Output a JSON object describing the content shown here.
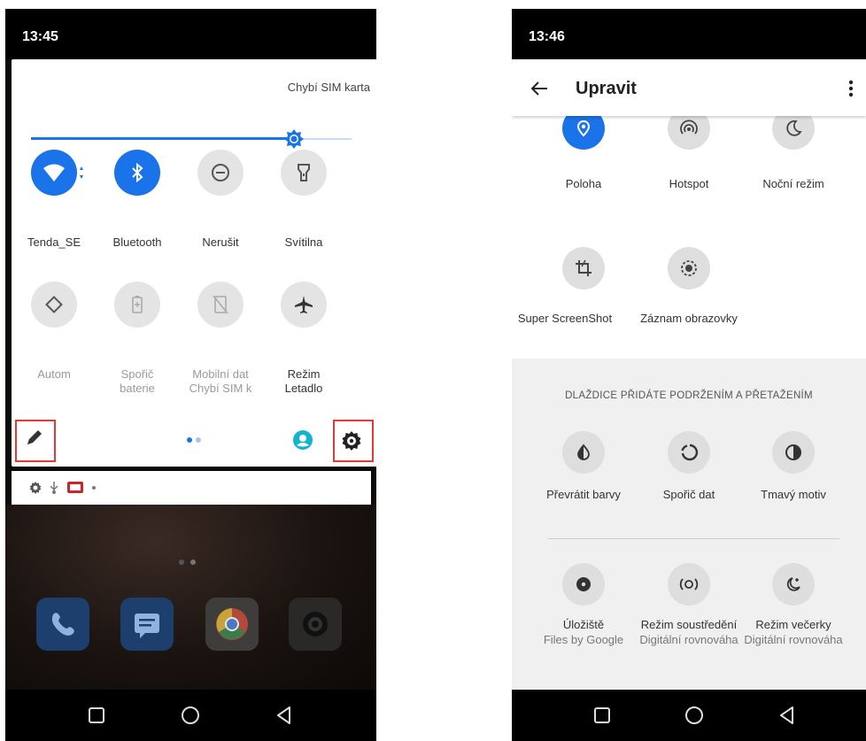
{
  "left": {
    "time": "13:45",
    "sim_status": "Chybí SIM karta",
    "brightness_level": 0.82,
    "tiles": [
      {
        "name": "wifi",
        "label": "Tenda_SE",
        "sub": "",
        "active": true
      },
      {
        "name": "bluetooth",
        "label": "Bluetooth",
        "sub": "",
        "active": true
      },
      {
        "name": "dnd",
        "label": "Nerušit",
        "sub": "",
        "active": false
      },
      {
        "name": "flashlight",
        "label": "Svítilna",
        "sub": "",
        "active": false
      },
      {
        "name": "autorotate",
        "label": "Autom",
        "sub": "",
        "active": false
      },
      {
        "name": "battery-saver",
        "label": "Spořič",
        "sub": "baterie",
        "active": false
      },
      {
        "name": "mobile-data",
        "label": "Mobilní dat",
        "sub": "Chybí SIM k",
        "active": false
      },
      {
        "name": "airplane",
        "label": "Režim",
        "sub": "Letadlo",
        "active": false
      }
    ],
    "page_indicator": {
      "pages": 2,
      "current": 1
    }
  },
  "right": {
    "time": "13:46",
    "title": "Upravit",
    "active_tiles": [
      {
        "label": "Poloha",
        "icon": "location-icon"
      },
      {
        "label": "Hotspot",
        "icon": "hotspot-icon"
      },
      {
        "label": "Noční režim",
        "icon": "moon-icon"
      },
      {
        "label": "Super ScreenShot",
        "icon": "crop-icon"
      },
      {
        "label": "Záznam obrazovky",
        "icon": "screen-record-icon"
      }
    ],
    "section_header": "DLAŽDICE PŘIDÁTE PODRŽENÍM A PŘETAŽENÍM",
    "available_tiles": [
      {
        "label": "Převrátit barvy",
        "sub": "",
        "icon": "invert-colors-icon"
      },
      {
        "label": "Spořič dat",
        "sub": "",
        "icon": "data-saver-icon"
      },
      {
        "label": "Tmavý motiv",
        "sub": "",
        "icon": "dark-theme-icon"
      },
      {
        "label": "Úložiště",
        "sub": "Files by Google",
        "icon": "storage-icon"
      },
      {
        "label": "Režim soustředění",
        "sub": "Digitální rovnováha",
        "icon": "focus-mode-icon"
      },
      {
        "label": "Režim večerky",
        "sub": "Digitální rovnováha",
        "icon": "bedtime-icon"
      }
    ]
  },
  "colors": {
    "accent": "#1a73e8",
    "highlight": "#e53935",
    "profile": "#12b5cb"
  }
}
